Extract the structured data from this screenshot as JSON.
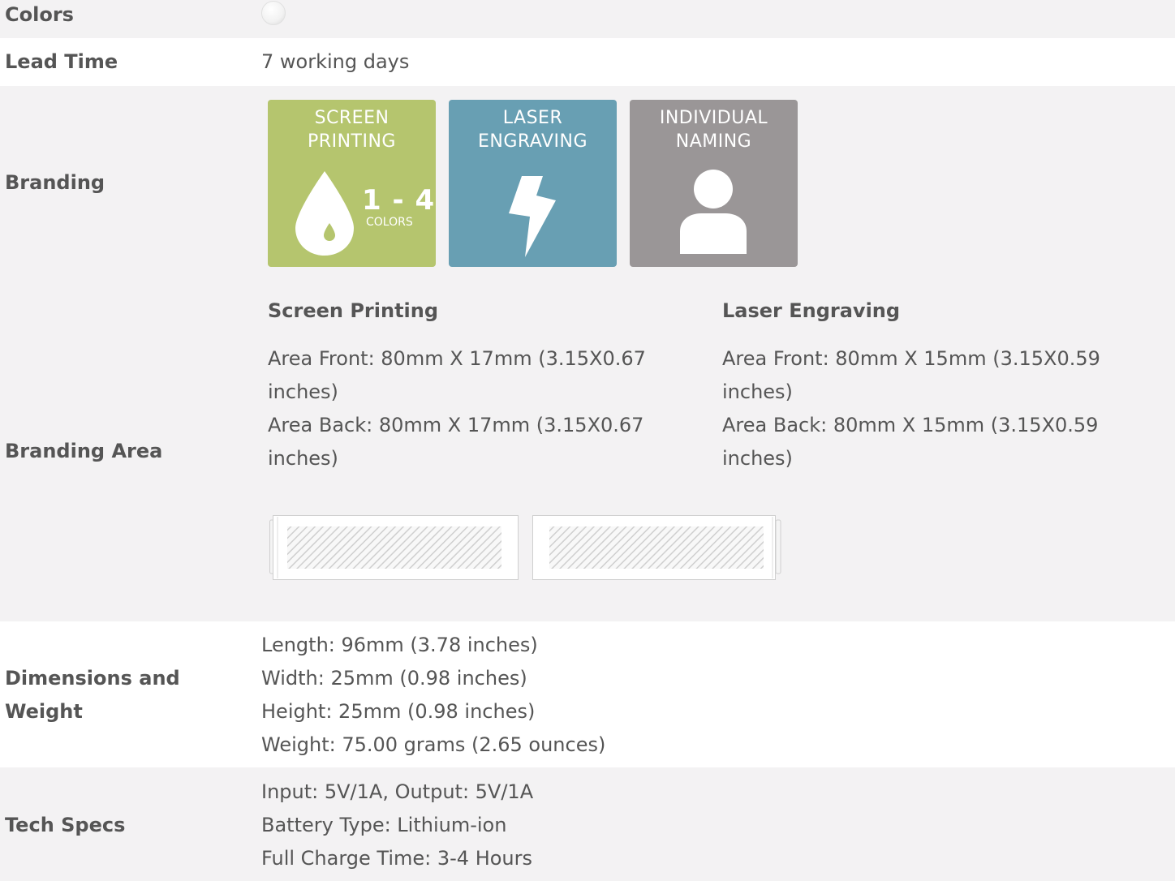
{
  "colors": {
    "label": "Colors",
    "swatches": [
      {
        "name": "white",
        "hex": "#ffffff"
      }
    ]
  },
  "lead_time": {
    "label": "Lead Time",
    "value": "7 working days"
  },
  "branding": {
    "label": "Branding",
    "tiles": [
      {
        "title_line1": "SCREEN",
        "title_line2": "PRINTING",
        "icon": "ink-drop-icon",
        "range": "1 - 4",
        "range_sub": "COLORS",
        "color": "#b5c56e"
      },
      {
        "title_line1": "LASER",
        "title_line2": "ENGRAVING",
        "icon": "lightning-bolt-icon",
        "color": "#689fb3"
      },
      {
        "title_line1": "INDIVIDUAL",
        "title_line2": "NAMING",
        "icon": "person-icon",
        "color": "#9a9697"
      }
    ]
  },
  "branding_area": {
    "label": "Branding Area",
    "screen_printing": {
      "heading": "Screen Printing",
      "front": "Area Front: 80mm X 17mm (3.15X0.67 inches)",
      "back": "Area Back: 80mm X 17mm (3.15X0.67 inches)"
    },
    "laser_engraving": {
      "heading": "Laser Engraving",
      "front": "Area Front: 80mm X 15mm (3.15X0.59 inches)",
      "back": "Area Back: 80mm X 15mm (3.15X0.59 inches)"
    }
  },
  "dimensions": {
    "label_line1": "Dimensions and",
    "label_line2": "Weight",
    "lines": [
      "Length: 96mm (3.78 inches)",
      "Width: 25mm (0.98 inches)",
      "Height: 25mm (0.98 inches)",
      "Weight: 75.00 grams (2.65 ounces)"
    ]
  },
  "tech_specs": {
    "label": "Tech Specs",
    "lines": [
      "Input: 5V/1A, Output: 5V/1A",
      "Battery Type: Lithium-ion",
      "Full Charge Time: 3-4 Hours"
    ]
  }
}
